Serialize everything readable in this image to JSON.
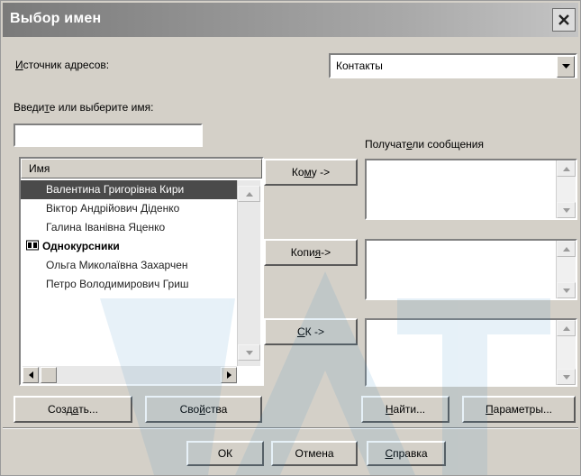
{
  "window": {
    "title": "Выбор имен"
  },
  "source": {
    "label_underlined": "И",
    "label_rest": "сточник адресов:",
    "selected": "Контакты"
  },
  "name_entry": {
    "label_pre": "Введи",
    "label_underlined": "т",
    "label_rest": "е или выберите имя:",
    "value": ""
  },
  "contacts": {
    "column_header": "Имя",
    "rows": [
      {
        "label": "Валентина Григорівна Кири",
        "selected": true
      },
      {
        "label": "Віктор Андрійович Діденко"
      },
      {
        "label": "Галина Іванівна Яценко"
      },
      {
        "label": "Однокурсники",
        "group": true
      },
      {
        "label": "Ольга Миколаївна Захарчен"
      },
      {
        "label": "Петро Володимирович Гриш"
      }
    ]
  },
  "recipients": {
    "header_pre": "Получат",
    "header_underlined": "е",
    "header_rest": "ли сообщения",
    "to_pre": "Ко",
    "to_underlined": "м",
    "to_rest": "у ->",
    "cc_pre": "Копи",
    "cc_underlined": "я",
    "cc_rest": " ->",
    "bcc_underlined": "С",
    "bcc_rest": "К ->"
  },
  "actions": {
    "create_pre": "Созд",
    "create_underlined": "а",
    "create_rest": "ть...",
    "properties_pre": "Сво",
    "properties_underlined": "й",
    "properties_rest": "ства",
    "find_underlined": "Н",
    "find_rest": "айти...",
    "params_underlined": "П",
    "params_rest": "араметры..."
  },
  "footer": {
    "ok": "ОК",
    "cancel": "Отмена",
    "help_underlined": "С",
    "help_rest": "правка"
  },
  "icons": [
    "close-icon",
    "dropdown-arrow-icon",
    "scroll-up-icon",
    "scroll-down-icon",
    "scroll-left-icon",
    "scroll-right-icon",
    "group-icon"
  ],
  "colors": {
    "title_bar": "#7a7a7a",
    "selection": "#4a4a4a",
    "dialog": "#d4d0c8",
    "watermark": "#3a8fc7"
  }
}
